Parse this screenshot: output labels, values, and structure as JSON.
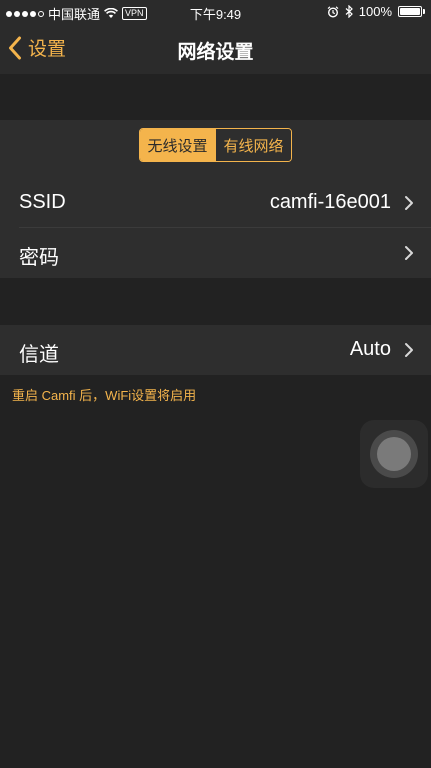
{
  "status_bar": {
    "carrier": "中国联通",
    "vpn": "VPN",
    "time": "下午9:49",
    "battery_text": "100%",
    "battery_level": 1.0,
    "signal_bars_filled": 4,
    "signal_bars_total": 5
  },
  "nav": {
    "back_label": "设置",
    "title": "网络设置"
  },
  "segment": {
    "options": [
      "无线设置",
      "有线网络"
    ],
    "selected_index": 0
  },
  "rows": {
    "ssid": {
      "label": "SSID",
      "value": "camfi-16e001"
    },
    "password": {
      "label": "密码"
    },
    "channel": {
      "label": "信道",
      "value": "Auto"
    }
  },
  "footer_note": "重启 Camfi 后，WiFi设置将启用",
  "colors": {
    "accent": "#f4b44c",
    "background": "#222222",
    "cell": "#2e2e2e"
  }
}
